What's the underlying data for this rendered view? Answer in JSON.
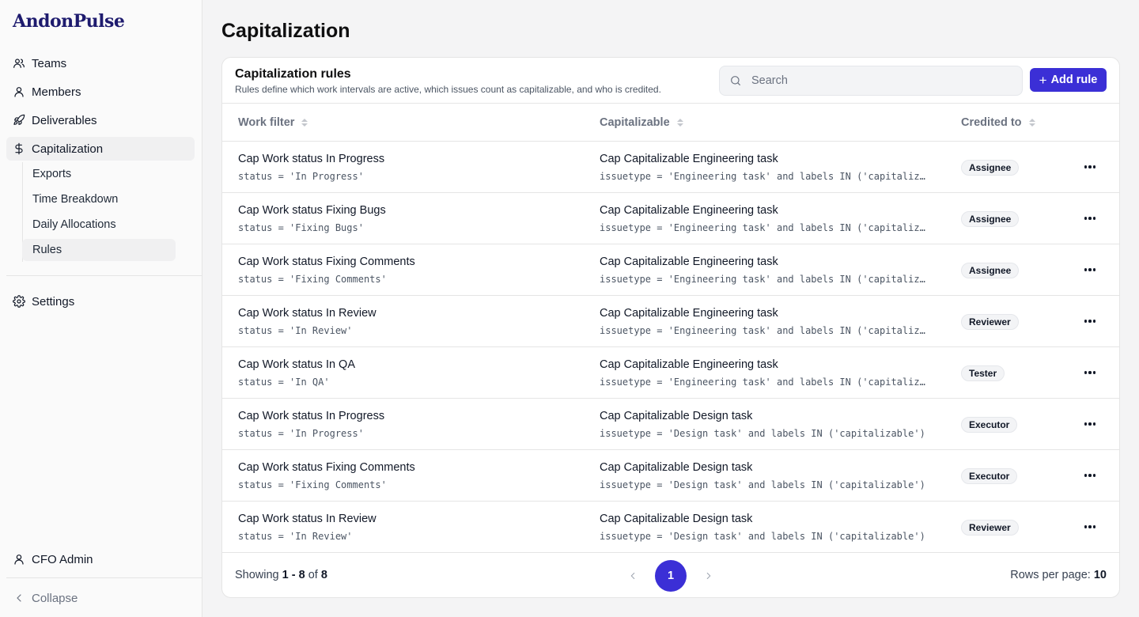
{
  "app": {
    "logo": "AndonPulse"
  },
  "sidebar": {
    "items": [
      {
        "label": "Teams",
        "icon": "users-icon"
      },
      {
        "label": "Members",
        "icon": "user-icon"
      },
      {
        "label": "Deliverables",
        "icon": "rocket-icon"
      },
      {
        "label": "Capitalization",
        "icon": "dollar-icon"
      }
    ],
    "subitems": [
      {
        "label": "Exports"
      },
      {
        "label": "Time Breakdown"
      },
      {
        "label": "Daily Allocations"
      },
      {
        "label": "Rules"
      }
    ],
    "settings": {
      "label": "Settings",
      "icon": "gear-icon"
    },
    "user": {
      "label": "CFO Admin",
      "icon": "user-icon"
    },
    "collapse": {
      "label": "Collapse",
      "icon": "chevron-left-icon"
    }
  },
  "page": {
    "title": "Capitalization"
  },
  "card": {
    "title": "Capitalization rules",
    "subtitle": "Rules define which work intervals are active, which issues count as capitalizable, and who is credited.",
    "search_placeholder": "Search",
    "add_label": "Add rule"
  },
  "table": {
    "columns": [
      "Work filter",
      "Capitalizable",
      "Credited to"
    ],
    "rows": [
      {
        "work": "Cap Work status In Progress",
        "work_code": "status = 'In Progress'",
        "cap": "Cap Capitalizable Engineering task",
        "cap_code": "issuetype = 'Engineering task' and labels IN ('capitalizable')",
        "credited": "Assignee"
      },
      {
        "work": "Cap Work status Fixing Bugs",
        "work_code": "status = 'Fixing Bugs'",
        "cap": "Cap Capitalizable Engineering task",
        "cap_code": "issuetype = 'Engineering task' and labels IN ('capitalizable')",
        "credited": "Assignee"
      },
      {
        "work": "Cap Work status Fixing Comments",
        "work_code": "status = 'Fixing Comments'",
        "cap": "Cap Capitalizable Engineering task",
        "cap_code": "issuetype = 'Engineering task' and labels IN ('capitalizable')",
        "credited": "Assignee"
      },
      {
        "work": "Cap Work status In Review",
        "work_code": "status = 'In Review'",
        "cap": "Cap Capitalizable Engineering task",
        "cap_code": "issuetype = 'Engineering task' and labels IN ('capitalizable')",
        "credited": "Reviewer"
      },
      {
        "work": "Cap Work status In QA",
        "work_code": "status = 'In QA'",
        "cap": "Cap Capitalizable Engineering task",
        "cap_code": "issuetype = 'Engineering task' and labels IN ('capitalizable')",
        "credited": "Tester"
      },
      {
        "work": "Cap Work status In Progress",
        "work_code": "status = 'In Progress'",
        "cap": "Cap Capitalizable Design task",
        "cap_code": "issuetype = 'Design task' and labels IN ('capitalizable')",
        "credited": "Executor"
      },
      {
        "work": "Cap Work status Fixing Comments",
        "work_code": "status = 'Fixing Comments'",
        "cap": "Cap Capitalizable Design task",
        "cap_code": "issuetype = 'Design task' and labels IN ('capitalizable')",
        "credited": "Executor"
      },
      {
        "work": "Cap Work status In Review",
        "work_code": "status = 'In Review'",
        "cap": "Cap Capitalizable Design task",
        "cap_code": "issuetype = 'Design task' and labels IN ('capitalizable')",
        "credited": "Reviewer"
      }
    ]
  },
  "footer": {
    "showing_prefix": "Showing",
    "range": "1 - 8",
    "of": "of",
    "total": "8",
    "page": "1",
    "rows_per_page_label": "Rows per page:",
    "rows_per_page": "10"
  },
  "colors": {
    "accent": "#3b2fd6",
    "logo": "#1e1b6e"
  }
}
